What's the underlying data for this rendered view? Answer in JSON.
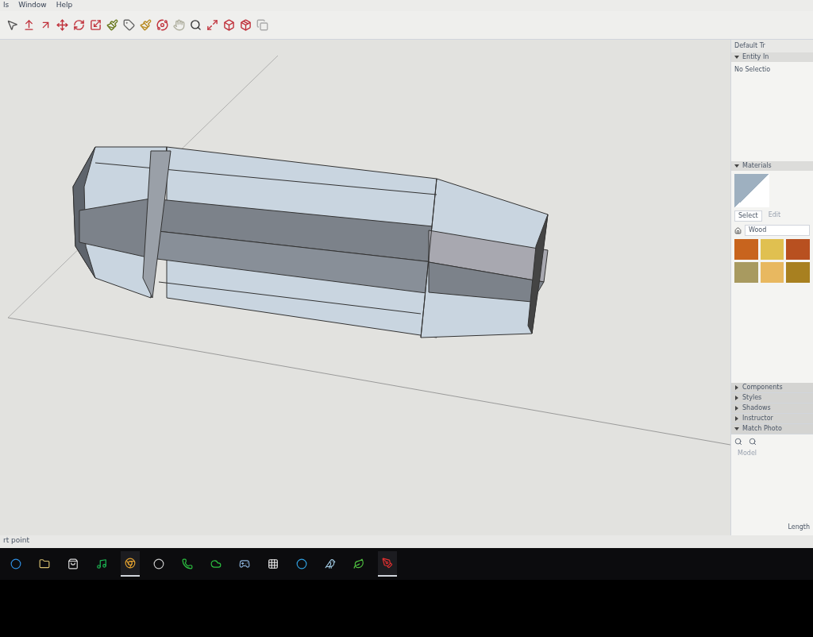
{
  "menu": [
    {
      "label": "ls"
    },
    {
      "label": "Window"
    },
    {
      "label": "Help"
    }
  ],
  "tray": {
    "title": "Default Tr",
    "entity_info": {
      "label": "Entity In",
      "expanded": true,
      "text": "No Selectio"
    },
    "materials": {
      "label": "Materials",
      "expanded": true,
      "tabs": [
        {
          "label": "Select",
          "selected": true
        },
        {
          "label": "Edit",
          "selected": false
        }
      ],
      "dropdown": "Wood",
      "swatches": [
        {
          "color": "#c8641e"
        },
        {
          "color": "#e0c050"
        },
        {
          "color": "#b85020"
        },
        {
          "color": "#a89a60"
        },
        {
          "color": "#e8b860"
        },
        {
          "color": "#a88020"
        }
      ]
    },
    "panels": [
      {
        "label": "Components",
        "expanded": false
      },
      {
        "label": "Styles",
        "expanded": false
      },
      {
        "label": "Shadows",
        "expanded": false
      },
      {
        "label": "Instructor",
        "expanded": false
      },
      {
        "label": "Match Photo",
        "expanded": true
      }
    ],
    "match_photo": {
      "model_label": "Model"
    },
    "length_label": "Length"
  },
  "status_bar": {
    "text": "rt point"
  },
  "taskbar": [
    {
      "kind": "edge",
      "running": false
    },
    {
      "kind": "folder",
      "running": false
    },
    {
      "kind": "store",
      "running": false
    },
    {
      "kind": "spotify",
      "running": false
    },
    {
      "kind": "chrome",
      "running": true
    },
    {
      "kind": "app",
      "running": false
    },
    {
      "kind": "phone",
      "running": false
    },
    {
      "kind": "cloud",
      "running": false
    },
    {
      "kind": "steam",
      "running": false
    },
    {
      "kind": "dots",
      "running": false
    },
    {
      "kind": "letter",
      "running": false
    },
    {
      "kind": "bird",
      "running": false
    },
    {
      "kind": "leaf",
      "running": false
    },
    {
      "kind": "sketch",
      "running": true
    }
  ]
}
